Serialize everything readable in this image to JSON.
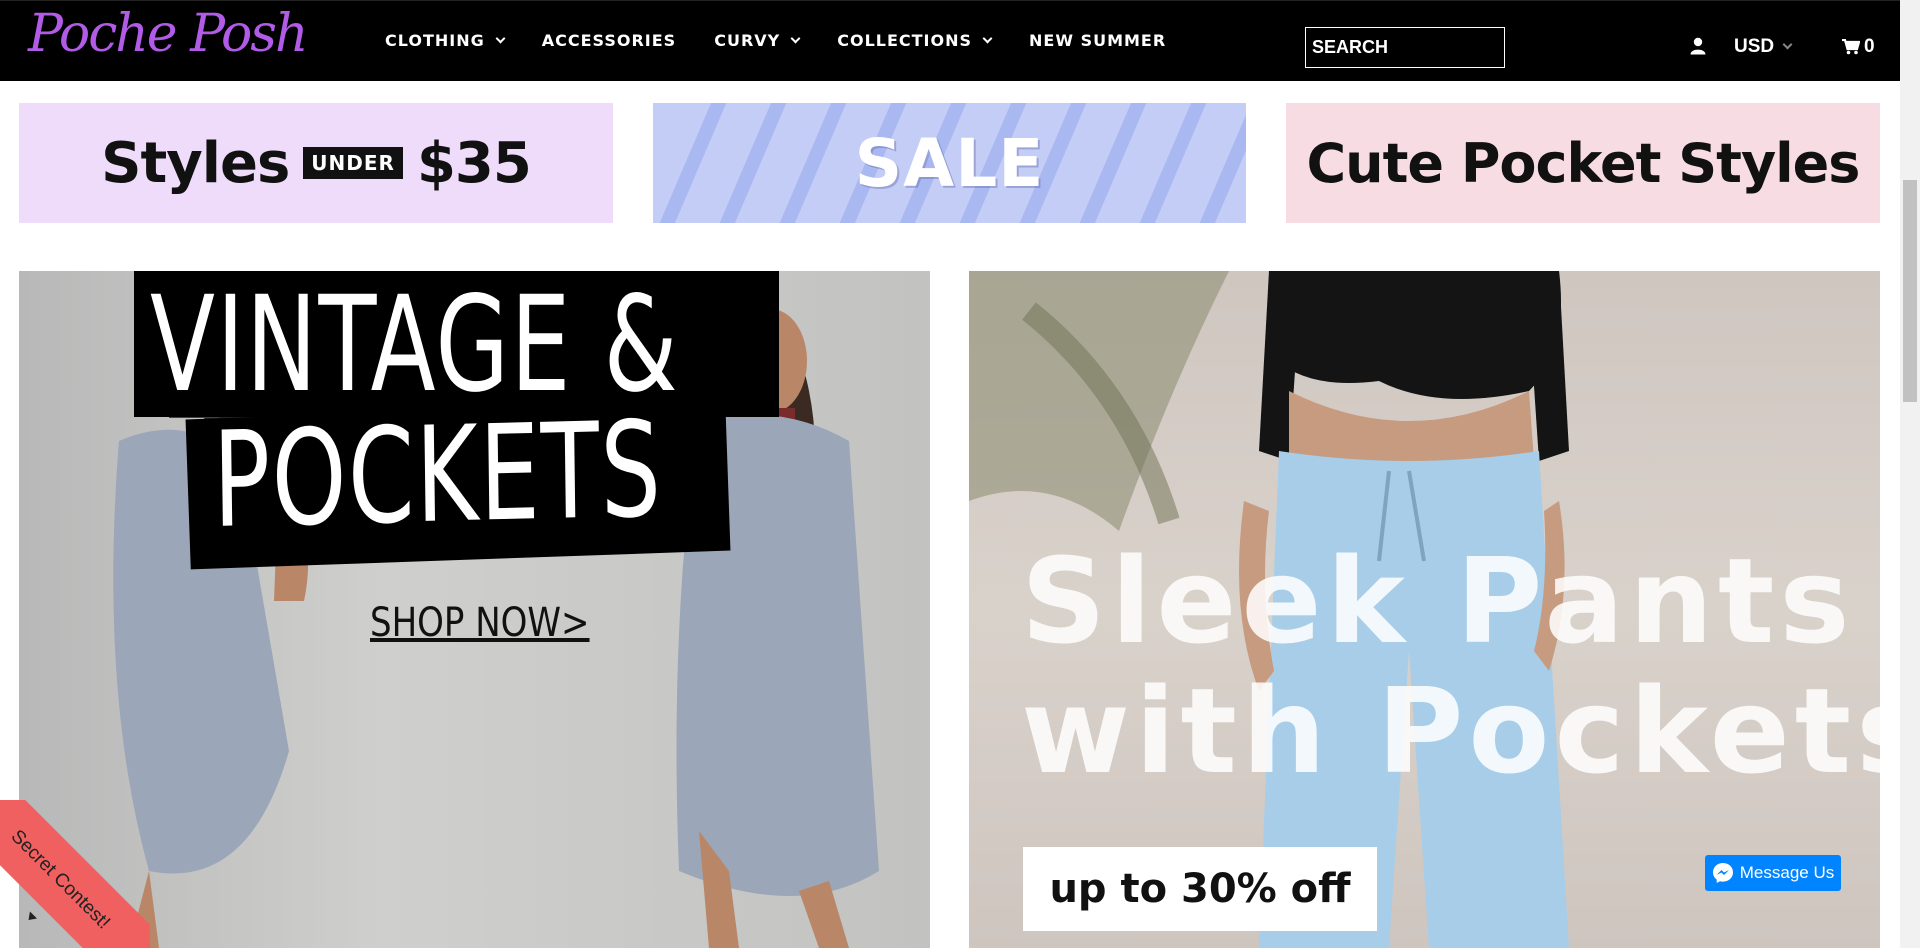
{
  "header": {
    "logo_text": "Poche Posh",
    "nav": [
      {
        "label": "CLOTHING",
        "has_dropdown": true
      },
      {
        "label": "ACCESSORIES",
        "has_dropdown": false
      },
      {
        "label": "CURVY",
        "has_dropdown": true
      },
      {
        "label": "COLLECTIONS",
        "has_dropdown": true
      },
      {
        "label": "NEW SUMMER",
        "has_dropdown": false
      }
    ],
    "search_placeholder": "SEARCH",
    "currency": "USD",
    "cart_count": "0",
    "icons": [
      "user-icon",
      "chevron-down-icon",
      "cart-icon"
    ]
  },
  "promos": {
    "styles_under": {
      "word1": "Styles",
      "badge": "UNDER",
      "price": "$35",
      "bg": "#eedcfa"
    },
    "sale": {
      "label": "SALE",
      "bg": "#c3cdf5"
    },
    "cute_pocket": {
      "label": "Cute Pocket Styles",
      "bg": "#f8dce4"
    }
  },
  "hero_left": {
    "line1": "VINTAGE &",
    "line2": "POCKETS",
    "cta": "SHOP NOW>"
  },
  "hero_right": {
    "line1": "Sleek Pants",
    "line2": "with Pockets",
    "badge": "up to 30% off"
  },
  "widgets": {
    "messenger_label": "Message Us",
    "contest_label": "Secret Contest!"
  },
  "colors": {
    "logo": "#b15be6",
    "messenger": "#0084ff",
    "contest": "#f06060"
  }
}
